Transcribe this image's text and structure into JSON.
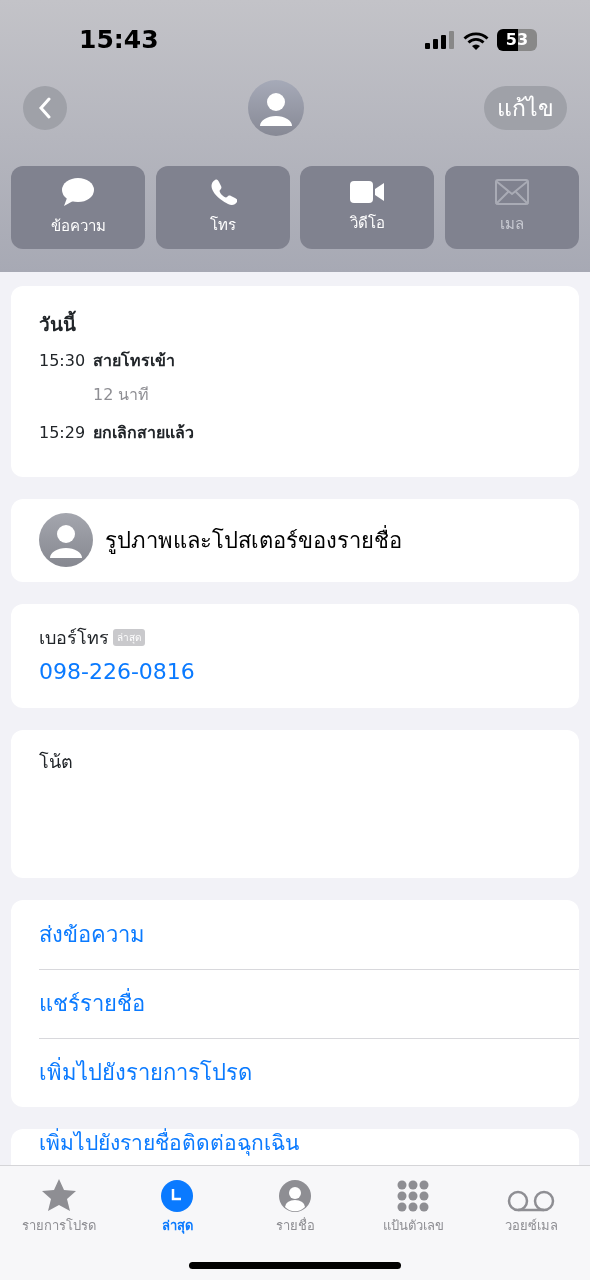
{
  "status_bar": {
    "time": "15:43",
    "battery": "53"
  },
  "nav": {
    "edit": "แก้ไข"
  },
  "actions": [
    {
      "kind": "message",
      "label": "ข้อความ",
      "disabled": false
    },
    {
      "kind": "call",
      "label": "โทร",
      "disabled": false
    },
    {
      "kind": "video",
      "label": "วิดีโอ",
      "disabled": false
    },
    {
      "kind": "mail",
      "label": "เมล",
      "disabled": true
    }
  ],
  "recents": {
    "title": "วันนี้",
    "calls": [
      {
        "time": "15:30",
        "label": "สายโทรเข้า",
        "detail": "12 นาที"
      },
      {
        "time": "15:29",
        "label": "ยกเลิกสายแล้ว"
      }
    ]
  },
  "contact_photo": {
    "label": "รูปภาพและโปสเตอร์ของรายชื่อ"
  },
  "phone": {
    "label": "เบอร์โทร",
    "badge": "ล่าสุด",
    "number": "098-226-0816"
  },
  "notes": {
    "label": "โน้ต"
  },
  "links": [
    "ส่งข้อความ",
    "แชร์รายชื่อ",
    "เพิ่มไปยังรายการโปรด"
  ],
  "emergency": {
    "label": "เพิ่มไปยังรายชื่อติดต่อฉุกเฉิน"
  },
  "tab_bar": [
    {
      "kind": "star",
      "label": "รายการโปรด",
      "selected": false
    },
    {
      "kind": "clock",
      "label": "ล่าสุด",
      "selected": true
    },
    {
      "kind": "person",
      "label": "รายชื่อ",
      "selected": false
    },
    {
      "kind": "keypad",
      "label": "แป้นตัวเลข",
      "selected": false
    },
    {
      "kind": "voicemail",
      "label": "วอยซ์เมล",
      "selected": false
    }
  ]
}
